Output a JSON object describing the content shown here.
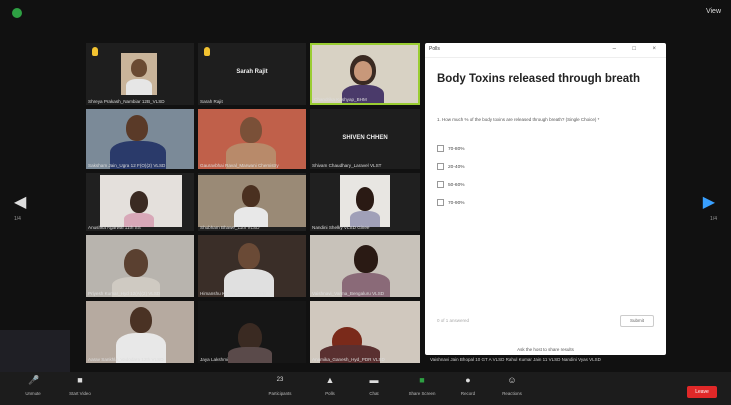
{
  "window": {
    "view_label": "View",
    "prev_page_label": "1/4",
    "next_page_label": "1/4"
  },
  "tiles": [
    {
      "name": "Shreya Prakash_Nambiar 12B_VLSD",
      "raise_hand": true
    },
    {
      "name": "Sarah Rajit",
      "center": "Sarah Rajit",
      "raise_hand": true
    },
    {
      "name": "Chandrika Kashyap_BHM",
      "active": true
    },
    {
      "name": "Saksham Jain_Ugra 12 F(O)(2) VLSD"
    },
    {
      "name": "Gauravbhai Raval_Marwani Chemistry"
    },
    {
      "name": "Shivam Chaudhary_Laravel VLST",
      "center": "SHIVEN CHHEN"
    },
    {
      "name": "Anushka Agarwal 11th SS"
    },
    {
      "name": "Shubham Bhawe_11th VLSD"
    },
    {
      "name": "Nandini Shelky VLSD Ginee"
    },
    {
      "name": "Priyesh Kumar_Hyd 12(A)(2) VLSD"
    },
    {
      "name": "Himanshu Kumar Sharma VLSD"
    },
    {
      "name": "Vaishnavi_Varma_Bengaluru VLSD"
    },
    {
      "name": "Aarav Sankhla_Vadodara 12th VLSD"
    },
    {
      "name": "Jaya Lakshmi"
    },
    {
      "name": "Anamika_Ganesh_Hyd_PDR VLSD"
    }
  ],
  "poll": {
    "app_title": "Polls",
    "title": "Body Toxins released through breath",
    "question": "1. How much % of the body toxins are released through breath? (Single Choice) *",
    "options": [
      "70-80%",
      "20-40%",
      "50-60%",
      "70-90%"
    ],
    "footer_note": "0 of 1 answered",
    "submit_label": "Submit",
    "banner": "Ask the host to share results"
  },
  "bottom_names": "Vaishnavi Jain Bhopal 10 GT A VLSD   Rahul Kumar Jain 11 VLSD   Nandini Vyas VLSD",
  "toolbar": {
    "unmute": "Unmute",
    "start_video": "Start Video",
    "participants": "Participants",
    "participants_count": "23",
    "polls": "Polls",
    "chat": "Chat",
    "share_screen": "Share Screen",
    "record": "Record",
    "reactions": "Reactions",
    "leave": "Leave"
  },
  "colors": {
    "accent_green": "#2ea043",
    "active_border": "#9acd32",
    "leave_red": "#e02828",
    "arrow_blue": "#39a0ff"
  }
}
